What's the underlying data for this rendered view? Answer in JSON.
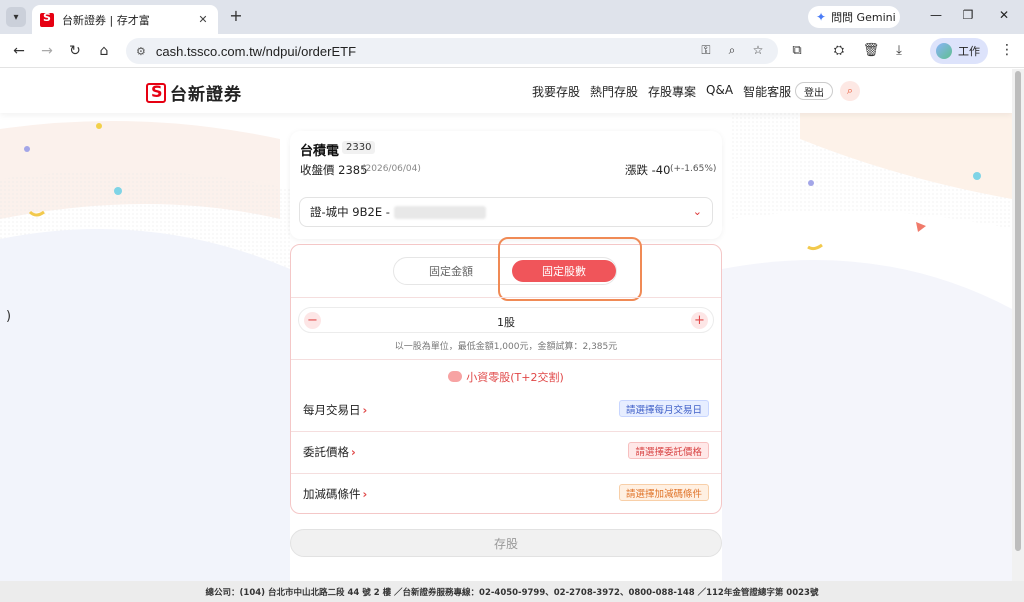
{
  "browser": {
    "tab_title": "台新證券 | 存才富",
    "url": "cash.tssco.com.tw/ndpui/orderETF",
    "gemini_label": "問問 Gemini",
    "profile_label": "工作"
  },
  "site": {
    "logo_text": "台新證券",
    "nav": [
      "我要存股",
      "熱門存股",
      "存股專案",
      "Q&A",
      "智能客服"
    ],
    "logout_label": "登出"
  },
  "stock": {
    "name": "台積電",
    "code": "2330",
    "close_label": "收盤價 2385",
    "close_date": "(2026/06/04)",
    "change_label": "漲跌 -40",
    "change_pct": "(+-1.65%)",
    "account_prefix": "證-城中 9B2E -"
  },
  "order": {
    "mode_amount": "固定金額",
    "mode_shares": "固定股數",
    "quantity": "1股",
    "hint": "以一股為單位，最低金額1,000元，金額試算：2,385元",
    "odd_lot": "小資零股(T+2交割)",
    "rows": [
      {
        "label": "每月交易日",
        "tag": "請選擇每月交易日",
        "tone": "blue"
      },
      {
        "label": "委託價格",
        "tag": "請選擇委託價格",
        "tone": "pink"
      },
      {
        "label": "加減碼條件",
        "tag": "請選擇加減碼條件",
        "tone": "orange"
      }
    ],
    "submit": "存股"
  },
  "footer": {
    "text": "總公司：(104) 台北市中山北路二段 44 號 2 樓 ／台新證券服務專線：02-4050-9799、02-2708-3972、0800-088-148 ／112年金管證總字第 0023號"
  },
  "colors": {
    "brand_red": "#e60012",
    "accent": "#f0555a",
    "highlight": "#f08a55"
  }
}
